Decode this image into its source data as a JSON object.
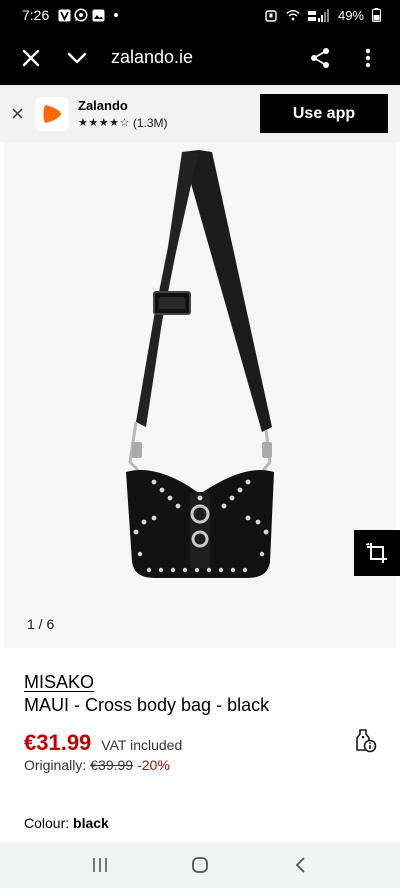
{
  "status_bar": {
    "time": "7:26",
    "battery": "49%"
  },
  "browser": {
    "url": "zalando.ie"
  },
  "app_banner": {
    "app_name": "Zalando",
    "stars": "★★★★☆",
    "rating_count": "(1.3M)",
    "use_app_label": "Use app",
    "brand_color": "#ff6900"
  },
  "gallery": {
    "counter": "1 / 6"
  },
  "product": {
    "brand": "MISAKO",
    "name": "MAUI - Cross body bag - black",
    "price": "€31.99",
    "vat": "VAT included",
    "original_label": "Originally:",
    "original_price": "€39.99",
    "discount": "-20%",
    "colour_label": "Colour:",
    "colour_value": "black"
  },
  "colors": {
    "sale_red": "#c40000",
    "dark": "#000000"
  }
}
